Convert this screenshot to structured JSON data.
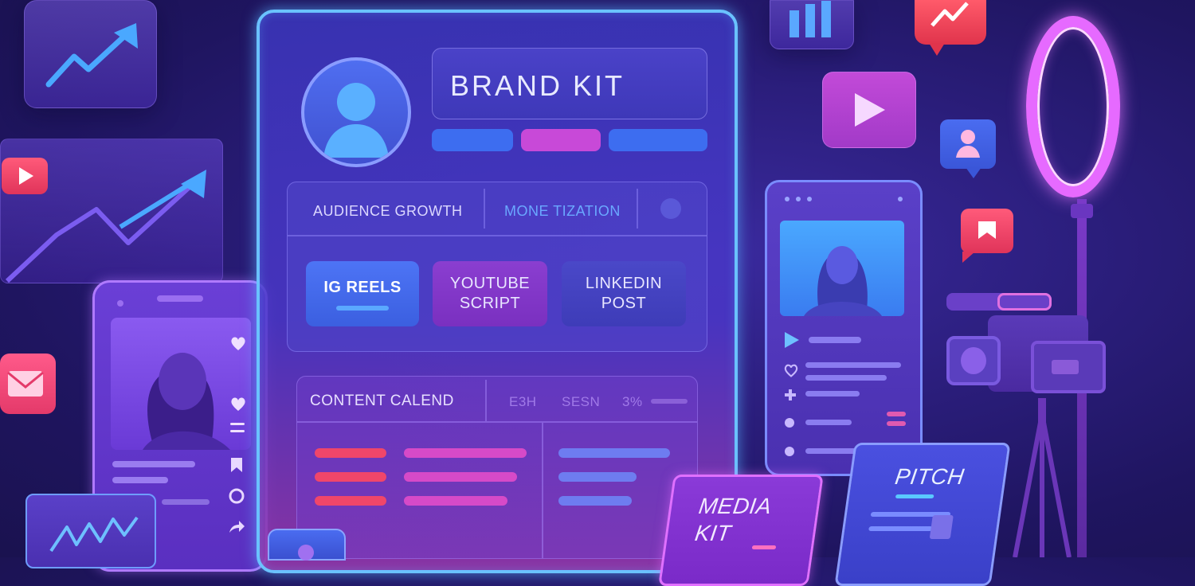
{
  "brand_kit": {
    "title": "BRAND KIT"
  },
  "tabs": {
    "audience": "AUDIENCE GROWTH",
    "monetization": "MONE TIZATION"
  },
  "content_types": [
    {
      "label": "IG REELS"
    },
    {
      "label": "YOUTUBE\nSCRIPT"
    },
    {
      "label": "LINKEDIN\nPOST"
    }
  ],
  "calendar": {
    "title": "CONTENT CALEND",
    "col_1": "E3H",
    "col_2": "SESN",
    "col_3": "3%"
  },
  "media_kit": "MEDIA\nKIT",
  "pitch": "PITCH",
  "colors": {
    "panel_border": "#6ac2ff",
    "accent_pink": "#e347c9",
    "accent_blue": "#3d6df0",
    "accent_red": "#f0466a"
  },
  "icons": [
    "trend-up-icon",
    "bar-chart-icon",
    "play-icon",
    "user-icon",
    "mail-icon",
    "heart-icon",
    "ring-light-icon",
    "camera-icon"
  ]
}
